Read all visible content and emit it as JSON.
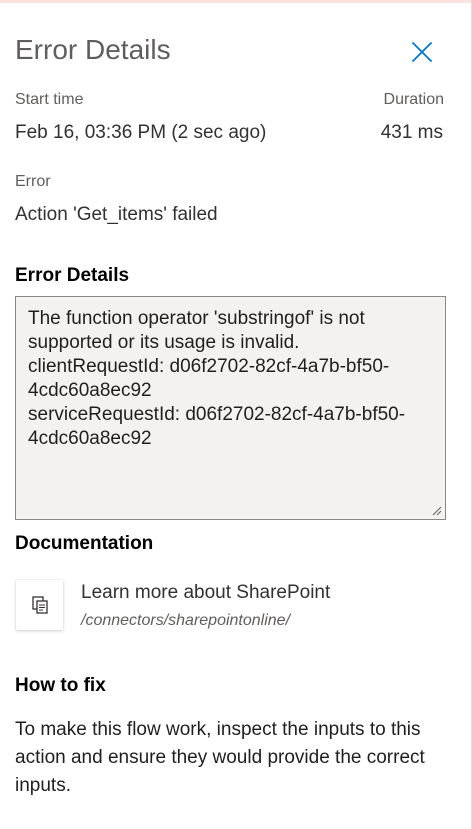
{
  "panel": {
    "title": "Error Details",
    "close_label": "Close"
  },
  "run": {
    "start_time_label": "Start time",
    "start_time_value": "Feb 16, 03:36 PM (2 sec ago)",
    "duration_label": "Duration",
    "duration_value": "431 ms"
  },
  "error": {
    "label": "Error",
    "message": "Action 'Get_items' failed"
  },
  "error_details": {
    "heading": "Error Details",
    "text": "The function operator 'substringof' is not supported or its usage is invalid.\nclientRequestId: d06f2702-82cf-4a7b-bf50-4cdc60a8ec92\nserviceRequestId: d06f2702-82cf-4a7b-bf50-4cdc60a8ec92"
  },
  "documentation": {
    "heading": "Documentation",
    "link_text": "Learn more about SharePoint",
    "link_path": "/connectors/sharepointonline/",
    "icon": "copy-document-icon"
  },
  "how_to_fix": {
    "heading": "How to fix",
    "text": "To make this flow work, inspect the inputs to this action and ensure they would provide the correct inputs."
  },
  "colors": {
    "accent_blue": "#0078d4",
    "top_accent": "#fbe3e4",
    "textarea_bg": "#f3f2f1"
  }
}
